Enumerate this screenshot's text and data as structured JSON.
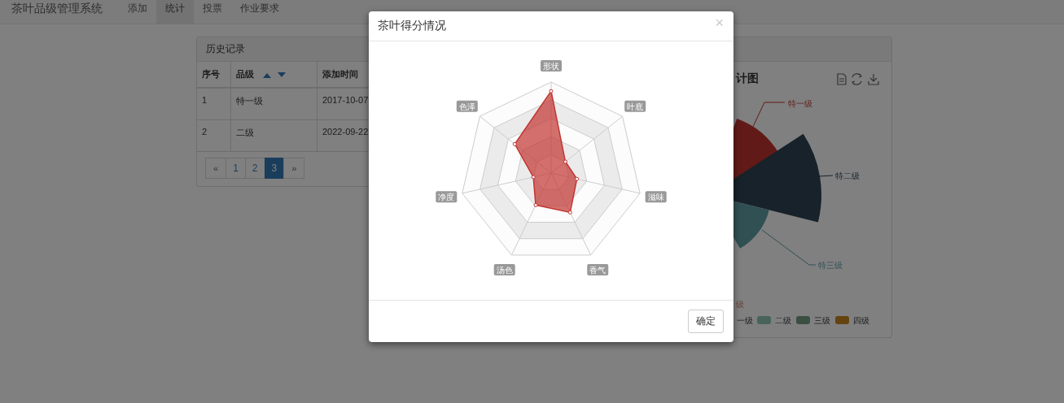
{
  "navbar": {
    "brand": "茶叶品级管理系统",
    "links": [
      {
        "label": "添加",
        "selected": false
      },
      {
        "label": "统计",
        "selected": true
      },
      {
        "label": "投票",
        "selected": false
      },
      {
        "label": "作业要求",
        "selected": false
      }
    ]
  },
  "history_panel": {
    "title": "历史记录",
    "table": {
      "columns": [
        "序号",
        "品级",
        "添加时间"
      ],
      "rows": [
        [
          "1",
          "特一级",
          "2017-10-07"
        ],
        [
          "2",
          "二级",
          "2022-09-22"
        ]
      ]
    },
    "pagination": [
      {
        "label": "«",
        "selected": false
      },
      {
        "label": "1",
        "selected": false
      },
      {
        "label": "2",
        "selected": false
      },
      {
        "label": "3",
        "selected": true
      },
      {
        "label": "»",
        "selected": false
      }
    ]
  },
  "chart_panel": {
    "title": "计图",
    "pie_labels": [
      {
        "label": "特一级",
        "color": "#611a18"
      },
      {
        "label": "特二级",
        "color": "#17222a"
      },
      {
        "label": "特三级",
        "color": "#305054"
      },
      {
        "label": "级",
        "color": "#6a4132"
      }
    ],
    "legend": [
      {
        "label": "一级"
      },
      {
        "label": "二级",
        "color": "#486357"
      },
      {
        "label": "三级",
        "color": "#3a4f41"
      },
      {
        "label": "四级",
        "color": "#654311"
      }
    ]
  },
  "modal": {
    "title": "茶叶得分情况",
    "close": "×",
    "radar_axes": [
      "形状",
      "叶底",
      "滋味",
      "香气",
      "汤色",
      "净度",
      "色泽"
    ],
    "ok_button": "确定"
  }
}
